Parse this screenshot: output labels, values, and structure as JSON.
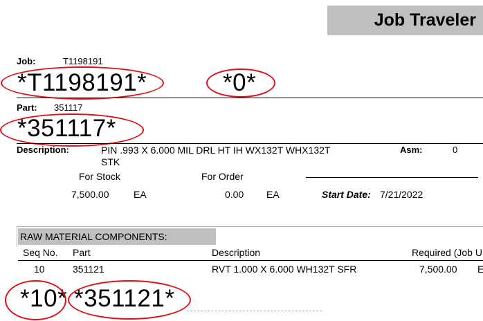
{
  "header": {
    "title": "Job Traveler"
  },
  "job": {
    "label": "Job:",
    "value": "T1198191",
    "barcode": "*T1198191*",
    "asm_barcode": "*0*"
  },
  "part": {
    "label": "Part:",
    "value": "351117",
    "barcode": "*351117*"
  },
  "description": {
    "label": "Description:",
    "line1": "PIN .993 X 6.000 MIL DRL HT IH WX132T WHX132T",
    "line2": "STK",
    "asm_label": "Asm:",
    "asm_value": "0"
  },
  "quantities": {
    "for_stock_label": "For Stock",
    "for_order_label": "For Order",
    "stock_qty": "7,500.00",
    "stock_uom": "EA",
    "order_qty": "0.00",
    "order_uom": "EA",
    "start_date_label": "Start Date:",
    "start_date_value": "7/21/2022"
  },
  "raw_material": {
    "section_title": "RAW MATERIAL COMPONENTS:",
    "columns": {
      "seq": "Seq No.",
      "part": "Part",
      "description": "Description",
      "required": "Required (Job U"
    },
    "row": {
      "seq": "10",
      "part": "351121",
      "description": "RVT 1.000 X 6.000 WH132T SFR",
      "required": "7,500.00",
      "uom": "E"
    },
    "seq_barcode": "*10*",
    "part_barcode": "*351121*"
  },
  "colors": {
    "annotation": "#e0101a",
    "header_fill": "#c0c0c0"
  }
}
